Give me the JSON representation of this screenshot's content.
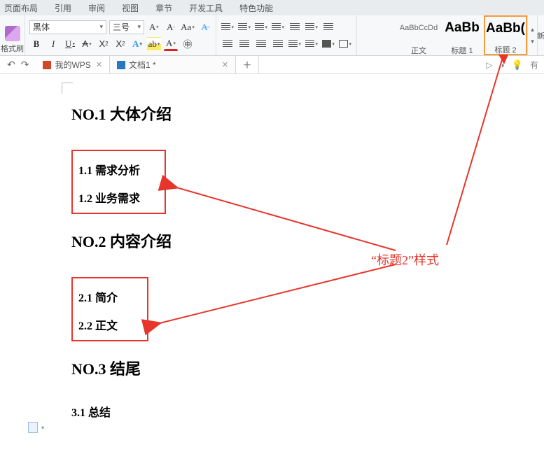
{
  "menu": {
    "items": [
      "页面布局",
      "引用",
      "审阅",
      "视图",
      "章节",
      "开发工具",
      "特色功能"
    ]
  },
  "ribbon": {
    "format_painter": "格式刷",
    "font_name": "黑体",
    "font_size": "三号",
    "buttons": {
      "bold": "B",
      "italic": "I",
      "underline": "U",
      "strike": "A",
      "super": "X",
      "sub": "X",
      "caseA": "A",
      "caseB": "A",
      "clear": "A"
    },
    "styles": [
      {
        "preview": "AaBbCcDd",
        "label": "正文",
        "big": false
      },
      {
        "preview": "AaBb",
        "label": "标题 1",
        "big": true
      },
      {
        "preview": "AaBb(",
        "label": "标题 2",
        "big": true
      }
    ],
    "right_edge": "新"
  },
  "tabs": {
    "my_wps": "我的WPS",
    "doc1": "文档1 *",
    "right_label": "有"
  },
  "doc": {
    "h1_1": "NO.1 大体介绍",
    "g1": {
      "a": "1.1 需求分析",
      "b": "1.2 业务需求"
    },
    "h1_2": "NO.2 内容介绍",
    "g2": {
      "a": "2.1 简介",
      "b": "2.2 正文"
    },
    "h1_3": "NO.3 结尾",
    "h3_1": "3.1 总结"
  },
  "annotation": {
    "label": "“标题2”样式"
  }
}
